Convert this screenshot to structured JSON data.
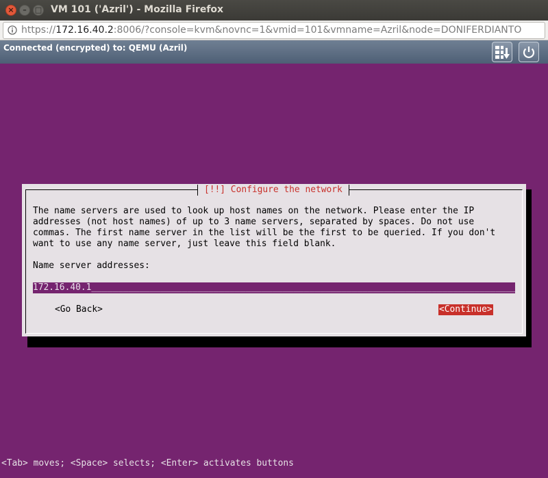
{
  "window": {
    "title": "VM 101 ('Azril') - Mozilla Firefox",
    "close_glyph": "×",
    "min_glyph": "–",
    "max_glyph": "□"
  },
  "url": {
    "prefix": "https://",
    "host": "172.16.40.2",
    "rest": ":8006/?console=kvm&novnc=1&vmid=101&vmname=Azril&node=DONIFERDIANTO"
  },
  "vnc": {
    "status": "Connected (encrypted) to: QEMU (Azril)",
    "keys_icon": "send-keys-icon",
    "power_icon": "power-icon"
  },
  "installer": {
    "dialog_title": "[!!] Configure the network",
    "description": "The name servers are used to look up host names on the network. Please enter the IP\naddresses (not host names) of up to 3 name servers, separated by spaces. Do not use\ncommas. The first name server in the list will be the first to be queried. If you don't\nwant to use any name server, just leave this field blank.",
    "field_label": "Name server addresses:",
    "field_value": "172.16.40.1",
    "go_back_label": "<Go Back>",
    "continue_label": "<Continue>",
    "help_hint": "<Tab> moves; <Space> selects; <Enter> activates buttons"
  },
  "colors": {
    "background": "#75246f",
    "dialog": "#e6e1e5",
    "accent_red": "#c8302a"
  }
}
